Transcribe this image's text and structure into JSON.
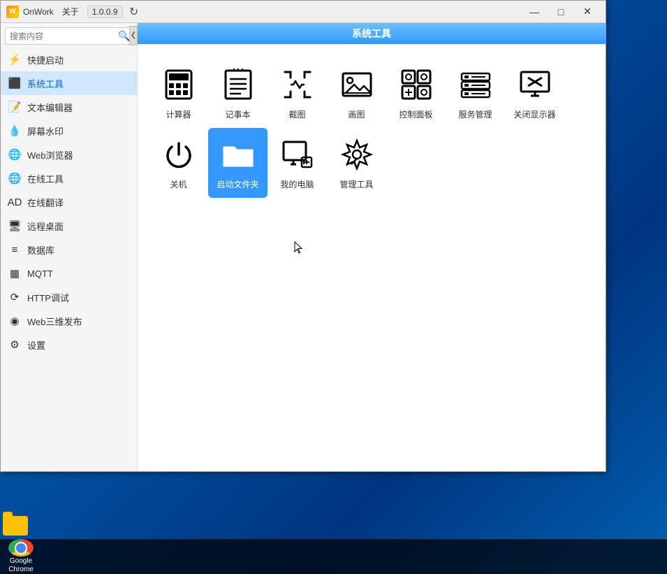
{
  "window": {
    "app_name": "OnWork",
    "about_menu": "关于",
    "version": "1.0.0.9",
    "title": "系统工具"
  },
  "sidebar": {
    "search_placeholder": "搜索内容",
    "items": [
      {
        "id": "quick-launch",
        "label": "快捷启动",
        "icon": "⚡"
      },
      {
        "id": "system-tools",
        "label": "系统工具",
        "icon": "🔧",
        "active": true
      },
      {
        "id": "text-editor",
        "label": "文本编辑器",
        "icon": "📝"
      },
      {
        "id": "watermark",
        "label": "屏幕水印",
        "icon": "💧"
      },
      {
        "id": "web-browser",
        "label": "Web浏览器",
        "icon": "🌐"
      },
      {
        "id": "online-tools",
        "label": "在线工具",
        "icon": "🌐"
      },
      {
        "id": "online-translate",
        "label": "在线翻译",
        "icon": "🅰"
      },
      {
        "id": "remote-desktop",
        "label": "远程桌面",
        "icon": "🖥"
      },
      {
        "id": "database",
        "label": "数据库",
        "icon": "💾"
      },
      {
        "id": "mqtt",
        "label": "MQTT",
        "icon": "📡"
      },
      {
        "id": "http-debug",
        "label": "HTTP调试",
        "icon": "🔁"
      },
      {
        "id": "web3d",
        "label": "Web三维发布",
        "icon": "🌐"
      },
      {
        "id": "settings",
        "label": "设置",
        "icon": "⚙"
      }
    ]
  },
  "content": {
    "title": "系统工具",
    "tools": [
      {
        "id": "calculator",
        "label": "计算器",
        "selected": false
      },
      {
        "id": "notepad",
        "label": "记事本",
        "selected": false
      },
      {
        "id": "screenshot",
        "label": "截图",
        "selected": false
      },
      {
        "id": "image-viewer",
        "label": "画图",
        "selected": false
      },
      {
        "id": "control-panel",
        "label": "控制面板",
        "selected": false
      },
      {
        "id": "service-manager",
        "label": "服务管理",
        "selected": false
      },
      {
        "id": "close-display",
        "label": "关闭显示器",
        "selected": false
      },
      {
        "id": "shutdown",
        "label": "关机",
        "selected": false
      },
      {
        "id": "startup-folder",
        "label": "启动文件夹",
        "selected": true
      },
      {
        "id": "my-computer",
        "label": "我的电脑",
        "selected": false
      },
      {
        "id": "management-tools",
        "label": "管理工具",
        "selected": false
      }
    ]
  },
  "taskbar": {
    "chrome_label": "Google\nChrome"
  }
}
